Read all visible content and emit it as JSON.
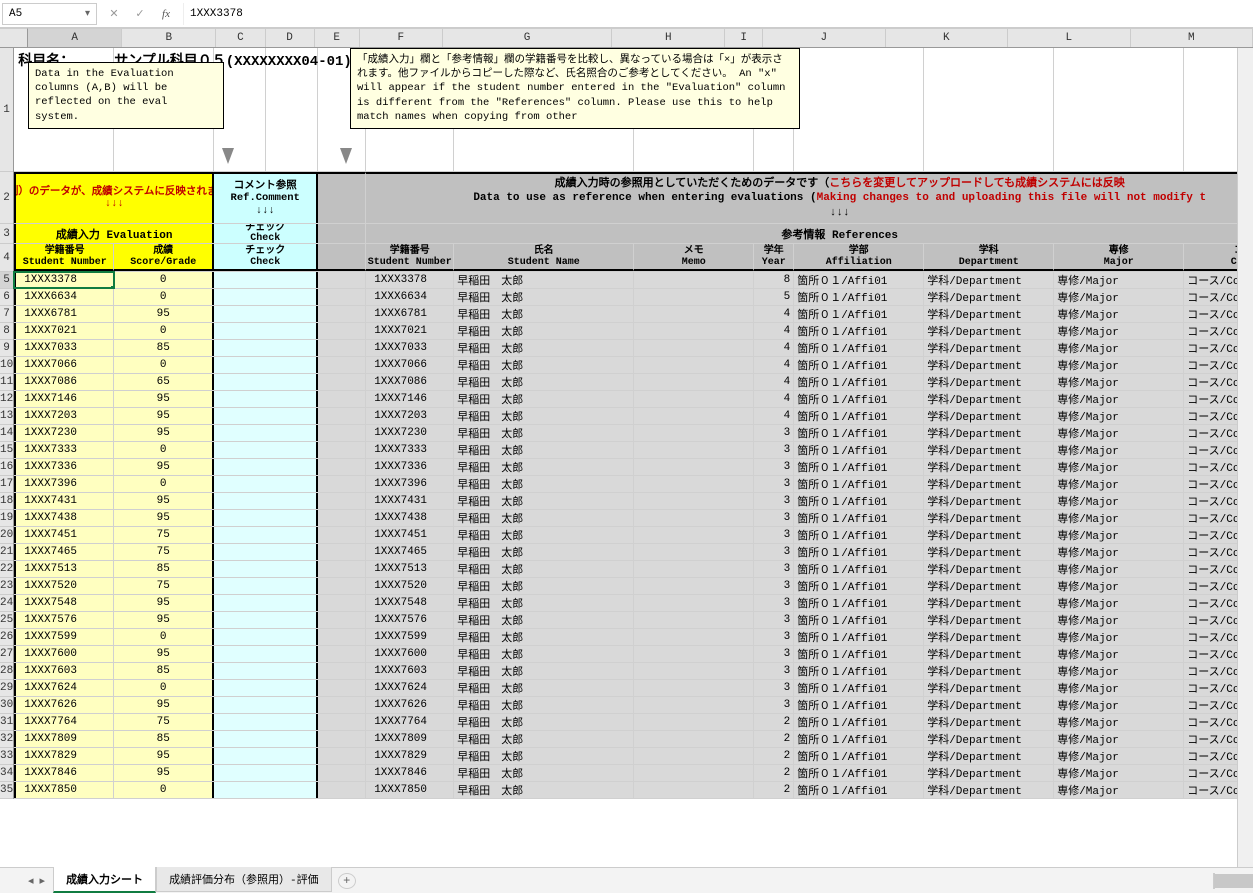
{
  "formula_bar": {
    "name_box": "A5",
    "formula": "1XXX3378"
  },
  "columns": [
    "A",
    "B",
    "C",
    "D",
    "E",
    "F",
    "G",
    "H",
    "I",
    "J",
    "K",
    "L",
    "M"
  ],
  "row1_height": 124,
  "subject_label": "科目名：",
  "subject_value": "サンプル科目０５(XXXXXXXX04-01)",
  "note1": "Data in the Evaluation columns (A,B) will be reflected on the eval system.",
  "note2": "「成績入力」欄と「参考情報」欄の学籍番号を比較し、異なっている場合は「×」が表示されます。他ファイルからコピーした際など、氏名照合のご参考としてください。\nAn \"x\" will appear if the student number entered in the \"Evaluation\" column is different from the \"References\" column. Please use this to help match names when copying from other",
  "hdr2": {
    "eval_red": "成績入力欄（A、B列）のデータが、成績システムに反映されます。Ref.Comment\n↓↓↓",
    "comment": "コメント参照\nRef.Comment\n↓↓↓",
    "ref_jp": "成績入力時の参照用としていただくためのデータです（",
    "ref_red": "こちらを変更してアップロードしても成績システムには反映",
    "ref_en1": "Data to use as reference when entering evaluations (",
    "ref_en_red": "Making changes to and uploading this file will not modify t",
    "ref_arrows": "↓↓↓"
  },
  "hdr3": {
    "eval": "成績入力 Evaluation",
    "check": "チェック\nCheck",
    "ref": "参考情報 References"
  },
  "hdr4": {
    "sn": "学籍番号\nStudent Number",
    "score": "成績\nScore/Grade",
    "sn2": "学籍番号\nStudent Number",
    "name": "氏名\nStudent Name",
    "memo": "メモ\nMemo",
    "year": "学年\nYear",
    "aff": "学部\nAffiliation",
    "dept": "学科\nDepartment",
    "major": "専修\nMajor",
    "course": "コース\nCourse"
  },
  "rows": [
    {
      "n": 5,
      "sn": "1XXX3378",
      "sc": "0",
      "yr": 8
    },
    {
      "n": 6,
      "sn": "1XXX6634",
      "sc": "0",
      "yr": 5
    },
    {
      "n": 7,
      "sn": "1XXX6781",
      "sc": "95",
      "yr": 4
    },
    {
      "n": 8,
      "sn": "1XXX7021",
      "sc": "0",
      "yr": 4
    },
    {
      "n": 9,
      "sn": "1XXX7033",
      "sc": "85",
      "yr": 4
    },
    {
      "n": 10,
      "sn": "1XXX7066",
      "sc": "0",
      "yr": 4
    },
    {
      "n": 11,
      "sn": "1XXX7086",
      "sc": "65",
      "yr": 4
    },
    {
      "n": 12,
      "sn": "1XXX7146",
      "sc": "95",
      "yr": 4
    },
    {
      "n": 13,
      "sn": "1XXX7203",
      "sc": "95",
      "yr": 4
    },
    {
      "n": 14,
      "sn": "1XXX7230",
      "sc": "95",
      "yr": 3
    },
    {
      "n": 15,
      "sn": "1XXX7333",
      "sc": "0",
      "yr": 3
    },
    {
      "n": 16,
      "sn": "1XXX7336",
      "sc": "95",
      "yr": 3
    },
    {
      "n": 17,
      "sn": "1XXX7396",
      "sc": "0",
      "yr": 3
    },
    {
      "n": 18,
      "sn": "1XXX7431",
      "sc": "95",
      "yr": 3
    },
    {
      "n": 19,
      "sn": "1XXX7438",
      "sc": "95",
      "yr": 3
    },
    {
      "n": 20,
      "sn": "1XXX7451",
      "sc": "75",
      "yr": 3
    },
    {
      "n": 21,
      "sn": "1XXX7465",
      "sc": "75",
      "yr": 3
    },
    {
      "n": 22,
      "sn": "1XXX7513",
      "sc": "85",
      "yr": 3
    },
    {
      "n": 23,
      "sn": "1XXX7520",
      "sc": "75",
      "yr": 3
    },
    {
      "n": 24,
      "sn": "1XXX7548",
      "sc": "95",
      "yr": 3
    },
    {
      "n": 25,
      "sn": "1XXX7576",
      "sc": "95",
      "yr": 3
    },
    {
      "n": 26,
      "sn": "1XXX7599",
      "sc": "0",
      "yr": 3
    },
    {
      "n": 27,
      "sn": "1XXX7600",
      "sc": "95",
      "yr": 3
    },
    {
      "n": 28,
      "sn": "1XXX7603",
      "sc": "85",
      "yr": 3
    },
    {
      "n": 29,
      "sn": "1XXX7624",
      "sc": "0",
      "yr": 3
    },
    {
      "n": 30,
      "sn": "1XXX7626",
      "sc": "95",
      "yr": 3
    },
    {
      "n": 31,
      "sn": "1XXX7764",
      "sc": "75",
      "yr": 2
    },
    {
      "n": 32,
      "sn": "1XXX7809",
      "sc": "85",
      "yr": 2
    },
    {
      "n": 33,
      "sn": "1XXX7829",
      "sc": "95",
      "yr": 2
    },
    {
      "n": 34,
      "sn": "1XXX7846",
      "sc": "95",
      "yr": 2
    },
    {
      "n": 35,
      "sn": "1XXX7850",
      "sc": "0",
      "yr": 2
    }
  ],
  "shared": {
    "name": "早稲田　太郎",
    "aff": "箇所０１/Affi01",
    "dept": "学科/Department",
    "major": "専修/Major",
    "course": "コース/Course"
  },
  "tabs": {
    "active": "成績入力シート",
    "inactive": "成績評価分布（参照用）-評価"
  }
}
